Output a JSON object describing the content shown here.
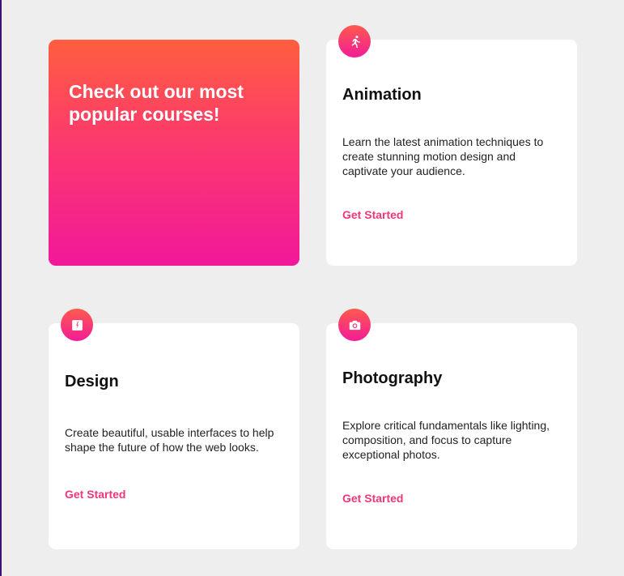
{
  "promo": {
    "title": "Check out our most popular courses!"
  },
  "courses": [
    {
      "icon": "running-person-icon",
      "title": "Animation",
      "description": "Learn the latest animation techniques to create stunning motion design and captivate your audience.",
      "cta": "Get Started"
    },
    {
      "icon": "pen-tool-icon",
      "title": "Design",
      "description": "Create beautiful, usable interfaces to help shape the future of how the web looks.",
      "cta": "Get Started"
    },
    {
      "icon": "camera-icon",
      "title": "Photography",
      "description": "Explore critical fundamentals like lighting, composition, and focus to capture exceptional photos.",
      "cta": "Get Started"
    }
  ],
  "colors": {
    "background": "#efeeef",
    "accent": "#f0367b",
    "gradient_start": "#ff5e3f",
    "gradient_end": "#f1189a"
  }
}
